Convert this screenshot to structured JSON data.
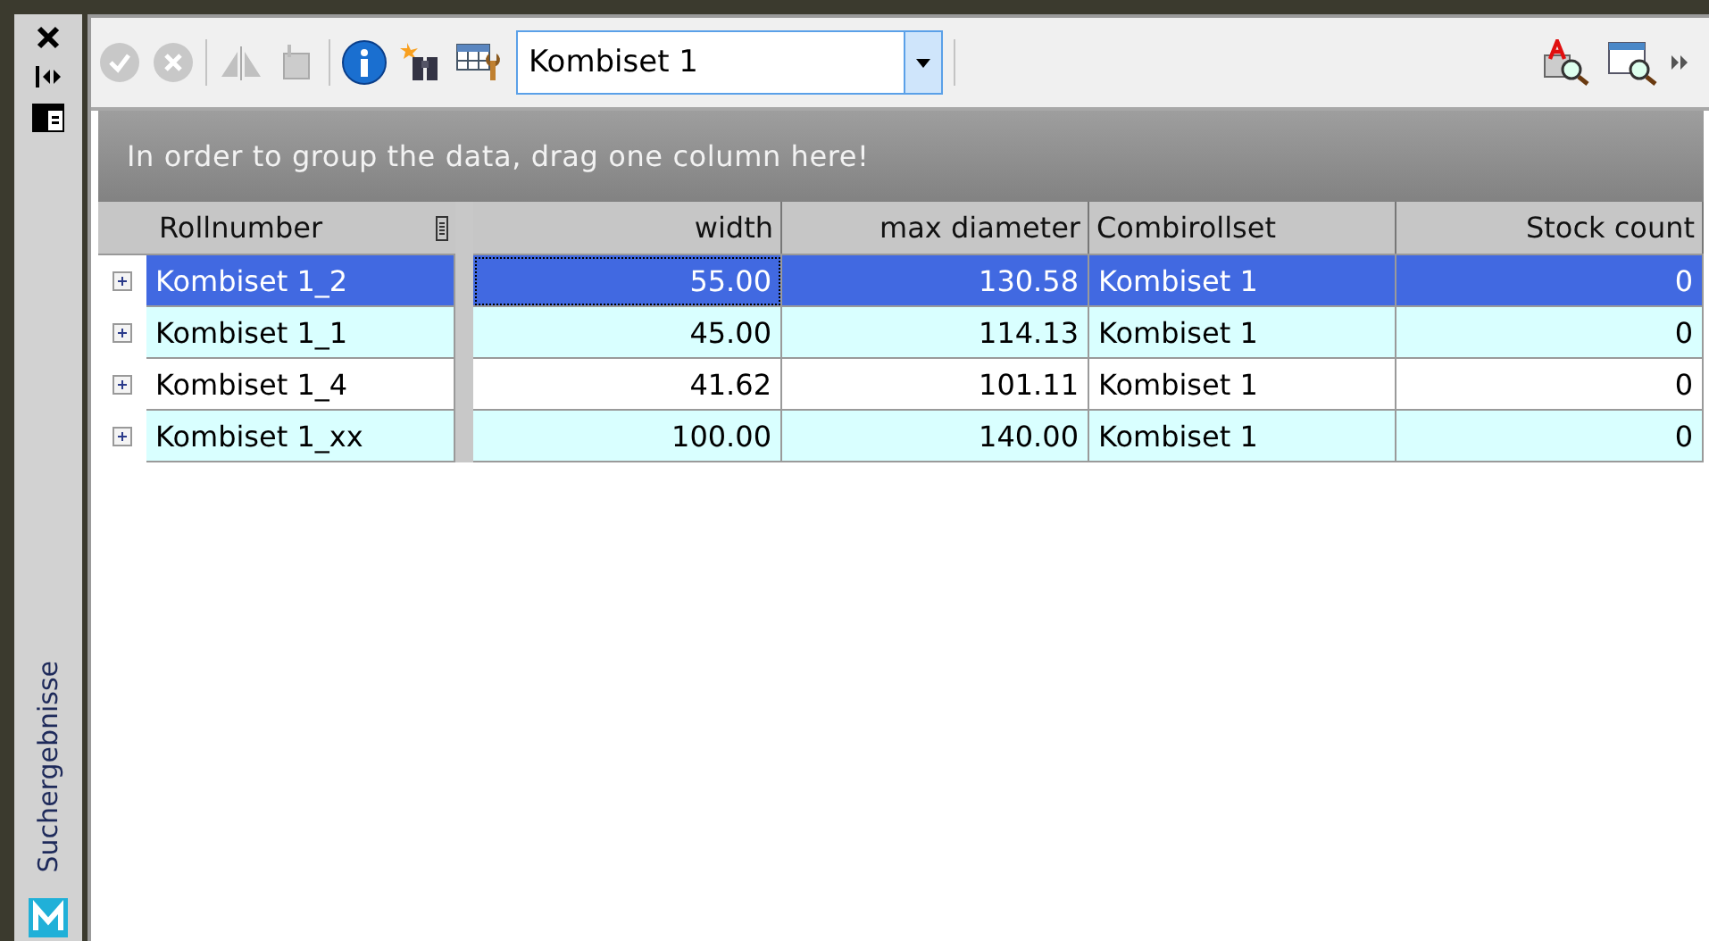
{
  "side_panel": {
    "title": "Suchergebnisse"
  },
  "toolbar": {
    "combo": {
      "value": "Kombiset 1"
    }
  },
  "group_bar": {
    "text": "In order to group the data, drag one column here!"
  },
  "table": {
    "columns": [
      {
        "label": "Rollnumber",
        "kind": "text"
      },
      {
        "label": "width",
        "kind": "number"
      },
      {
        "label": "max diameter",
        "kind": "number"
      },
      {
        "label": "Combirollset",
        "kind": "text"
      },
      {
        "label": "Stock count",
        "kind": "number"
      }
    ],
    "rows": [
      {
        "selected": true,
        "cells": [
          "Kombiset 1_2",
          "55.00",
          "130.58",
          "Kombiset 1",
          "0"
        ]
      },
      {
        "selected": false,
        "cells": [
          "Kombiset 1_1",
          "45.00",
          "114.13",
          "Kombiset 1",
          "0"
        ]
      },
      {
        "selected": false,
        "cells": [
          "Kombiset 1_4",
          "41.62",
          "101.11",
          "Kombiset 1",
          "0"
        ]
      },
      {
        "selected": false,
        "cells": [
          "Kombiset 1_xx",
          "100.00",
          "140.00",
          "Kombiset 1",
          "0"
        ]
      }
    ]
  }
}
